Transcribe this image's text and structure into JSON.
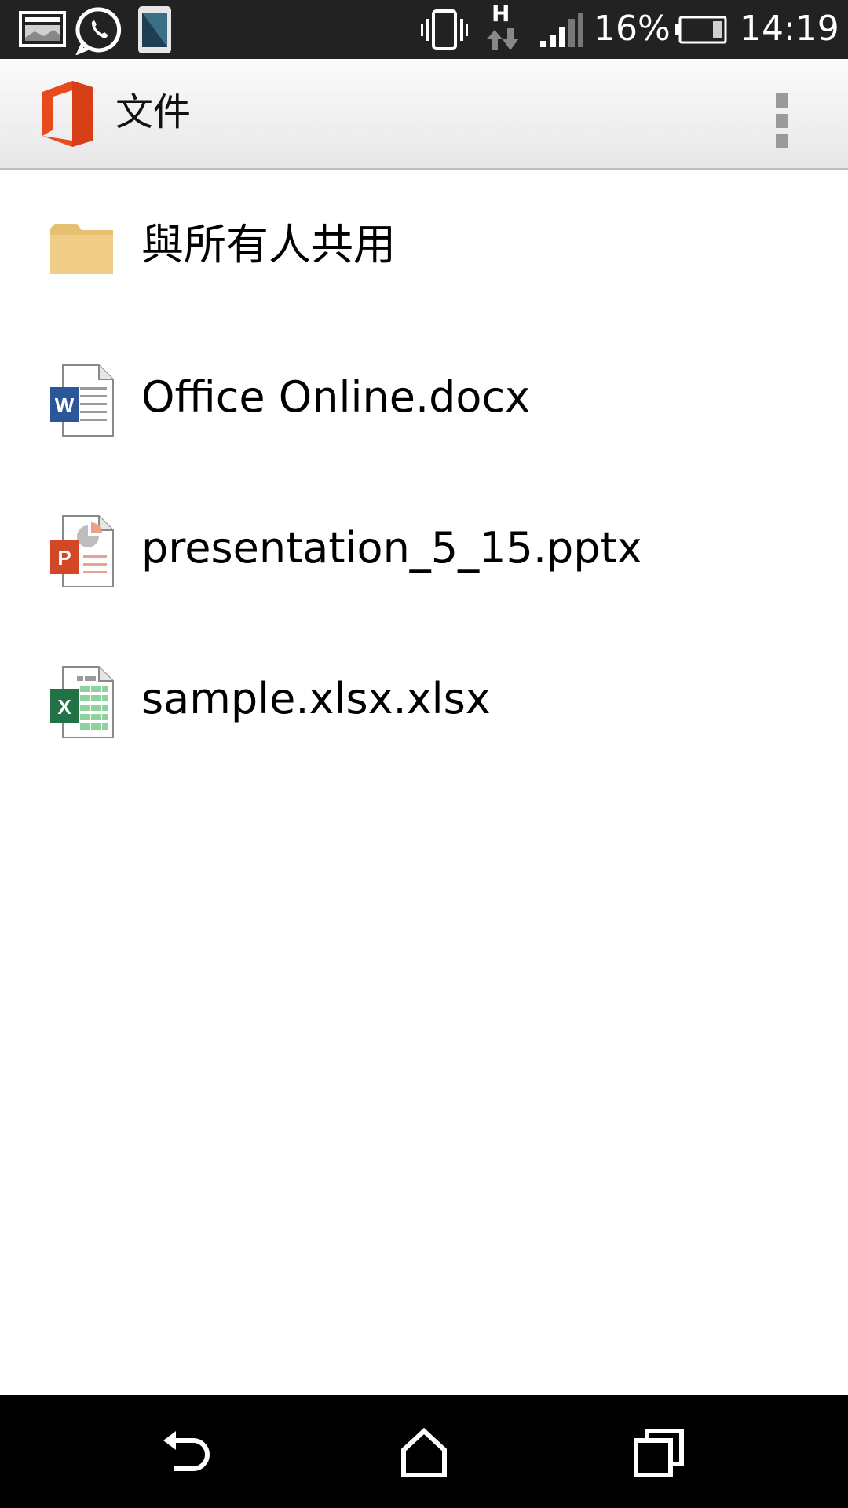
{
  "status_bar": {
    "battery_percent": "16%",
    "time": "14:19",
    "network_type": "H",
    "icons": [
      "gallery-icon",
      "whatsapp-icon",
      "phone-screen-icon",
      "vibrate-icon",
      "data-transfer-icon",
      "signal-icon",
      "battery-icon"
    ]
  },
  "action_bar": {
    "title": "文件",
    "logo": "office-logo-icon",
    "menu": "overflow-menu-icon"
  },
  "files": [
    {
      "name": "與所有人共用",
      "icon": "folder-icon"
    },
    {
      "name": "Office Online.docx",
      "icon": "word-doc-icon"
    },
    {
      "name": "presentation_5_15.pptx",
      "icon": "powerpoint-doc-icon"
    },
    {
      "name": "sample.xlsx.xlsx",
      "icon": "excel-doc-icon"
    }
  ],
  "nav_bar": {
    "buttons": [
      "back-icon",
      "home-icon",
      "recent-apps-icon"
    ]
  },
  "colors": {
    "office_orange": "#e8491d",
    "folder": "#f0cd86",
    "word_blue": "#2b579a",
    "ppt_orange": "#d24726",
    "excel_green": "#217346",
    "status_bar_bg": "#222222",
    "nav_bar_bg": "#000000"
  }
}
